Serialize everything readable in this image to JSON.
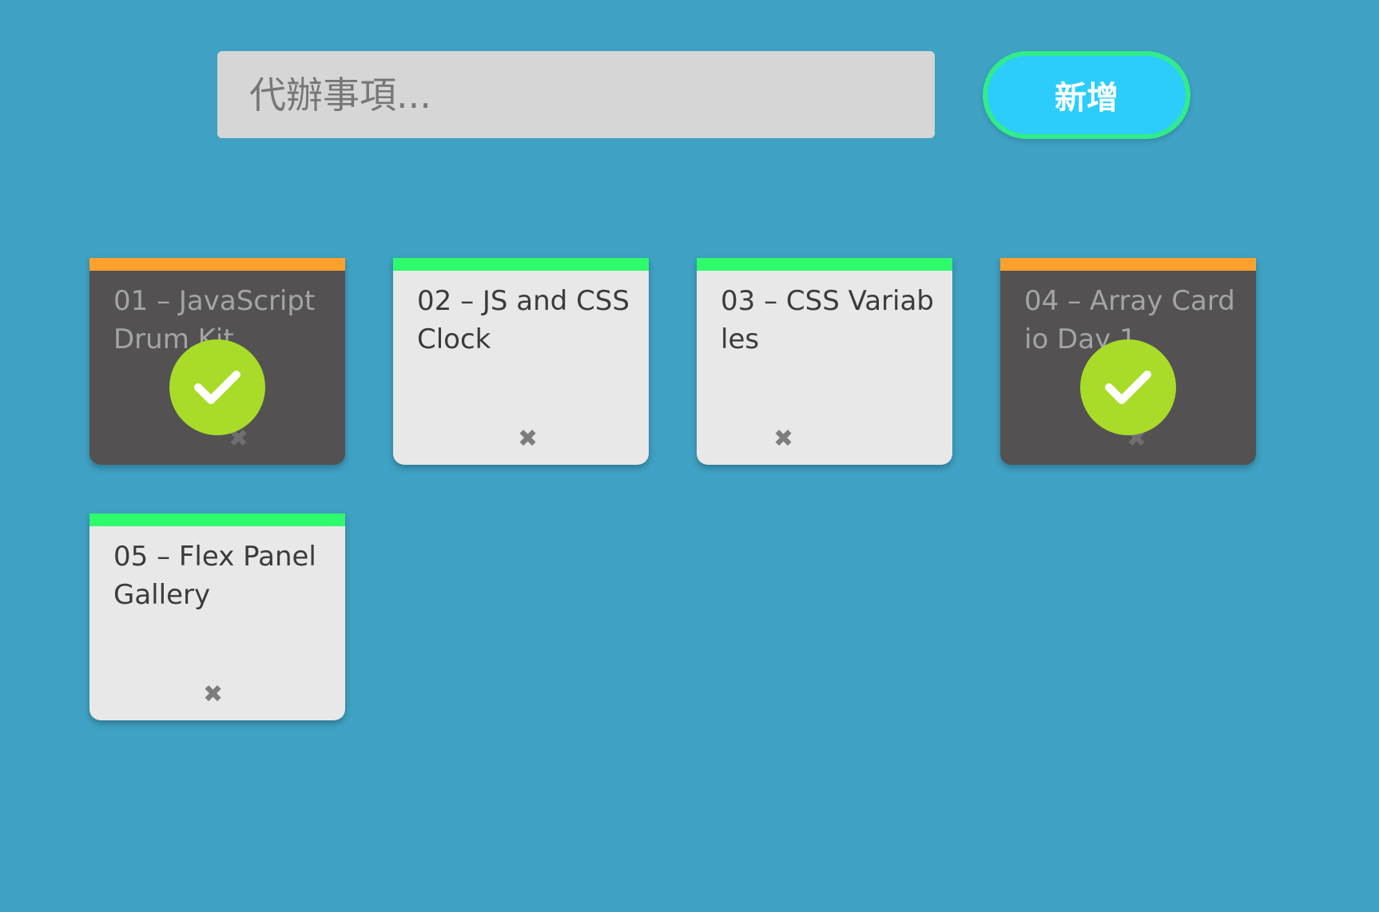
{
  "input": {
    "placeholder": "代辦事項...",
    "value": ""
  },
  "add_button": {
    "label": "新增"
  },
  "colors": {
    "background": "#3fa1c3",
    "done_stripe": "#ffa12c",
    "todo_stripe": "#2efc6c",
    "check_badge": "#a8dc28"
  },
  "cards": [
    {
      "title": "01 – JavaScript Drum Kit",
      "status": "done",
      "delete_icon": "close-icon",
      "check_icon": "check-icon"
    },
    {
      "title": "02 – JS and CSS Clock",
      "status": "todo",
      "delete_icon": "close-icon"
    },
    {
      "title": "03 – CSS Variables",
      "status": "todo",
      "delete_icon": "close-icon"
    },
    {
      "title": "04 – Array Cardio Day 1",
      "status": "done",
      "delete_icon": "close-icon",
      "check_icon": "check-icon"
    },
    {
      "title": "05 – Flex Panel Gallery",
      "status": "todo",
      "delete_icon": "close-icon"
    }
  ]
}
